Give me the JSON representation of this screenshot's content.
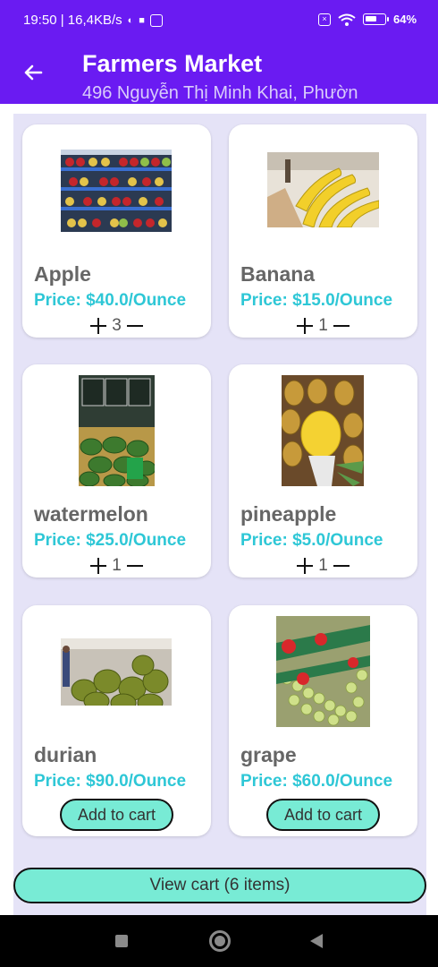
{
  "status_bar": {
    "time_speed": "19:50 | 16,4KB/s",
    "battery": "64",
    "battery_level_percent": 64,
    "icons": [
      "notification-icon",
      "camera-icon",
      "app-icon",
      "sim-off-icon",
      "wifi-icon",
      "battery-icon"
    ]
  },
  "app_bar": {
    "title": "Farmers Market",
    "subtitle": "496 Nguyễn Thị Minh Khai, Phườn",
    "back_icon": "arrow-left-icon"
  },
  "products": [
    {
      "name": "Apple",
      "price": "Price: $40.0/Ounce",
      "quantity": "3",
      "image": "apple-shelf"
    },
    {
      "name": "Banana",
      "price": "Price: $15.0/Ounce",
      "quantity": "1",
      "image": "banana-pile"
    },
    {
      "name": "watermelon",
      "price": "Price: $25.0/Ounce",
      "quantity": "1",
      "image": "watermelon-market"
    },
    {
      "name": "pineapple",
      "price": "Price: $5.0/Ounce",
      "quantity": "1",
      "image": "pineapple-box"
    },
    {
      "name": "durian",
      "price": "Price: $90.0/Ounce",
      "button": "Add to cart",
      "image": "durian-market"
    },
    {
      "name": "grape",
      "price": "Price: $60.0/Ounce",
      "button": "Add to cart",
      "image": "grape-bag"
    }
  ],
  "view_cart": {
    "label": "View cart (6 items)"
  },
  "colors": {
    "primary": "#6a1bf2",
    "accent": "#78ebd5",
    "price": "#2ec7d6",
    "background": "#e5e3f7"
  }
}
